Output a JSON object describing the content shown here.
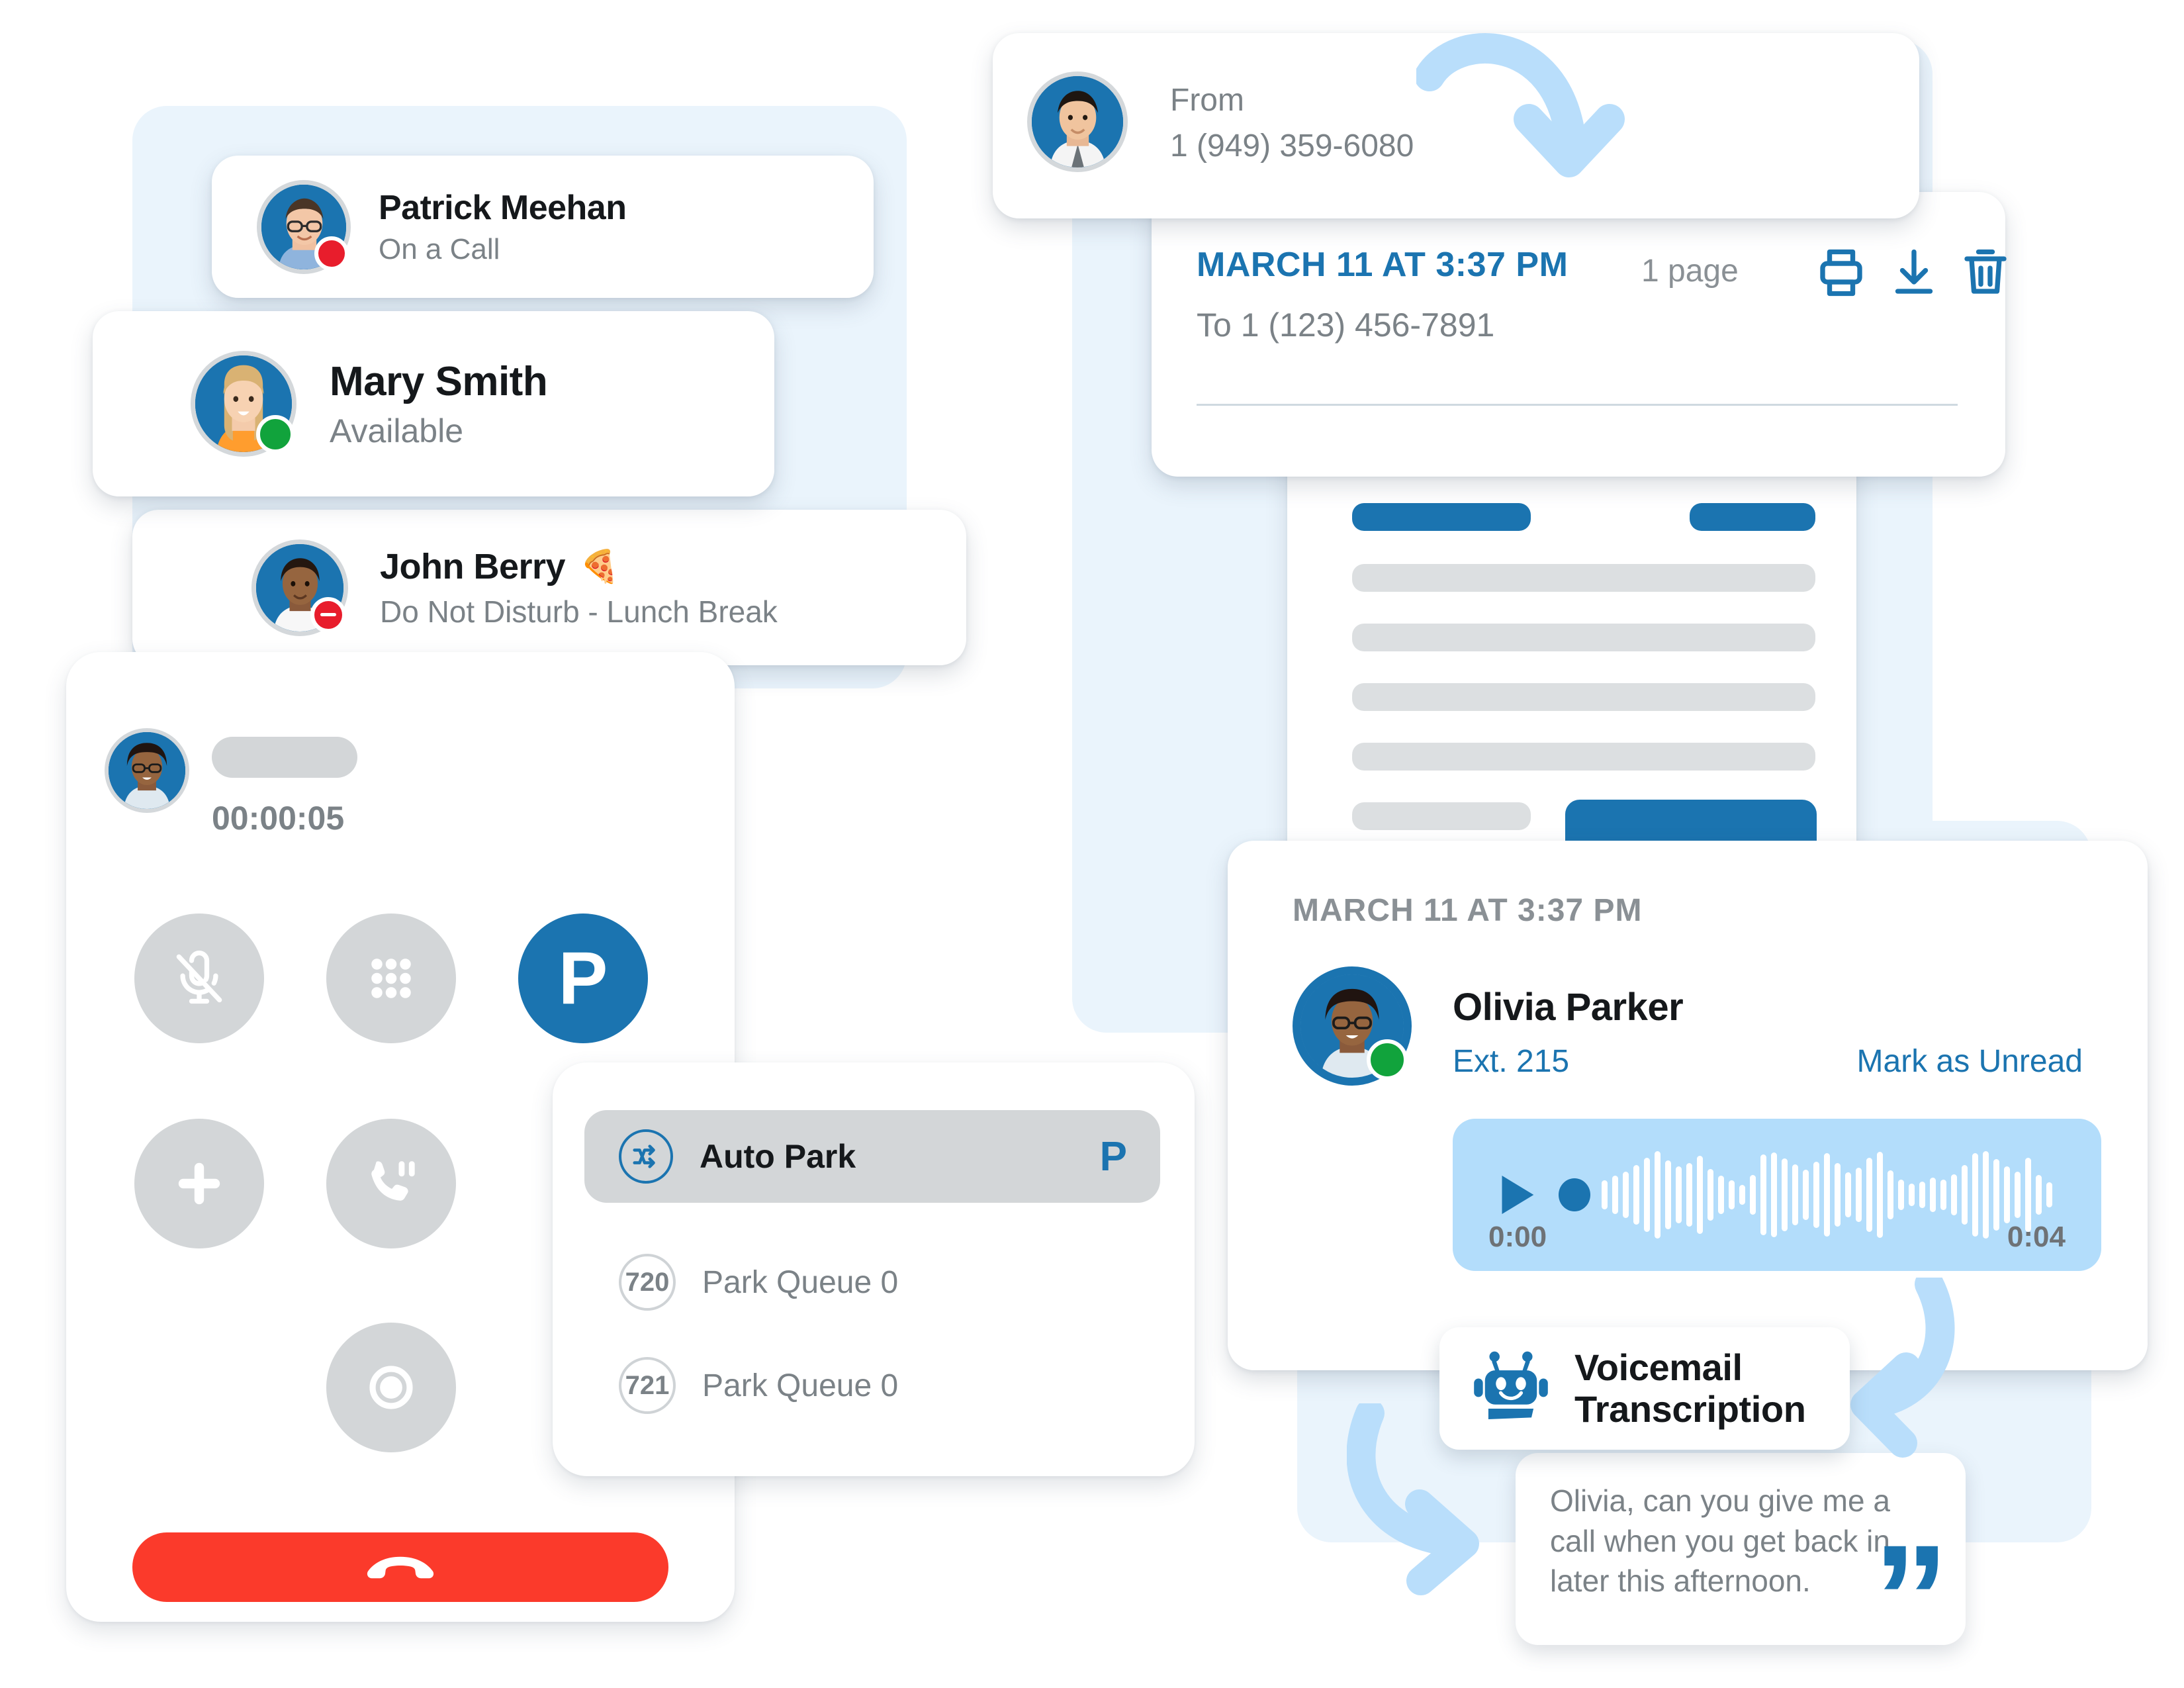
{
  "colors": {
    "brand_blue": "#1b74b0",
    "panel_blue": "#eaf4fc",
    "player_blue": "#b3ddfb",
    "arrow_blue": "#b9defb",
    "status_available": "#11a33c",
    "status_busy": "#e81d2c",
    "hangup_red": "#fb3a2b",
    "muted_gray": "#7b8287",
    "control_gray": "#d3d6d8"
  },
  "presence_list": {
    "contacts": [
      {
        "name": "Patrick Meehan",
        "status": "On a Call",
        "presence": "busy",
        "emoji": ""
      },
      {
        "name": "Mary Smith",
        "status": "Available",
        "presence": "available",
        "emoji": ""
      },
      {
        "name": "John Berry",
        "status": "Do Not Disturb - Lunch Break",
        "presence": "dnd",
        "emoji": "🍕"
      }
    ]
  },
  "fax": {
    "from_label": "From",
    "from_number": "1 (949) 359-6080",
    "date": "MARCH 11 AT 3:37 PM",
    "to_line": "To 1 (123) 456-7891",
    "pages": "1 page",
    "actions": [
      {
        "name": "print-icon",
        "label": "Print"
      },
      {
        "name": "download-icon",
        "label": "Download"
      },
      {
        "name": "trash-icon",
        "label": "Delete"
      }
    ]
  },
  "dialer": {
    "timer": "00:00:05",
    "caller_name_redacted": "",
    "buttons": [
      {
        "name": "mute-button",
        "icon": "mic-off-icon",
        "label": "Mute"
      },
      {
        "name": "keypad-button",
        "icon": "keypad-icon",
        "label": "Keypad"
      },
      {
        "name": "park-button",
        "icon": "park-p-icon",
        "label": "P"
      },
      {
        "name": "add-call-button",
        "icon": "plus-icon",
        "label": "Add Call"
      },
      {
        "name": "hold-button",
        "icon": "phone-pause-icon",
        "label": "Hold"
      },
      {
        "name": "record-button",
        "icon": "record-icon",
        "label": "Record"
      }
    ],
    "hangup_label": "End Call"
  },
  "park_menu": {
    "selected": {
      "label": "Auto Park",
      "badge": "P",
      "icon": "shuffle-icon"
    },
    "queues": [
      {
        "ext": "720",
        "label": "Park Queue 0"
      },
      {
        "ext": "721",
        "label": "Park Queue 0"
      }
    ]
  },
  "voicemail": {
    "date": "MARCH 11 AT 3:37 PM",
    "caller_name": "Olivia Parker",
    "extension": "Ext. 215",
    "mark_unread": "Mark as Unread",
    "player": {
      "current_time": "0:00",
      "duration": "0:04",
      "play_label": "Play"
    },
    "transcription_badge": {
      "line1": "Voicemail",
      "line2": "Transcription",
      "icon": "robot-icon"
    },
    "transcript": "Olivia, can you give me a call when you get back in later this afternoon.",
    "quote_glyph": "”"
  }
}
